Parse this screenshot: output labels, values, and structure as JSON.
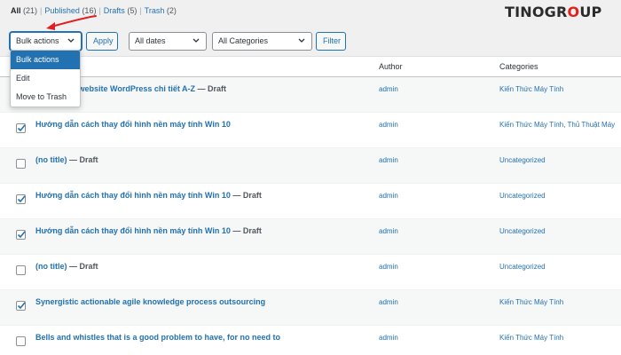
{
  "filters_nav": {
    "all_label": "All",
    "all_count": "(21)",
    "published_label": "Published",
    "published_count": "(16)",
    "drafts_label": "Drafts",
    "drafts_count": "(5)",
    "trash_label": "Trash",
    "trash_count": "(2)"
  },
  "brand": {
    "part1": "TINO",
    "part2": "GR",
    "o": "O",
    "part3": "UP"
  },
  "toolbar": {
    "bulk_actions_value": "Bulk actions",
    "apply_label": "Apply",
    "dates_value": "All dates",
    "categories_value": "All Categories",
    "filter_label": "Filter"
  },
  "bulk_menu": {
    "options": [
      "Bulk actions",
      "Edit",
      "Move to Trash"
    ]
  },
  "table": {
    "headers": {
      "author": "Author",
      "categories": "Categories"
    },
    "rows": [
      {
        "checked": false,
        "title": "i đăng trên website WordPress chi tiết A-Z",
        "state": "— Draft",
        "author": "admin",
        "categories": "Kiến Thức Máy Tính"
      },
      {
        "checked": true,
        "title": "Hướng dẫn cách thay đổi hình nền máy tính Win 10",
        "state": "",
        "author": "admin",
        "categories": "Kiến Thức Máy Tính, Thủ Thuật Máy"
      },
      {
        "checked": false,
        "title": "(no title)",
        "state": "— Draft",
        "author": "admin",
        "categories": "Uncategorized"
      },
      {
        "checked": true,
        "title": "Hướng dẫn cách thay đổi hình nền máy tính Win 10",
        "state": "— Draft",
        "author": "admin",
        "categories": "Uncategorized"
      },
      {
        "checked": true,
        "title": "Hướng dẫn cách thay đổi hình nền máy tính Win 10",
        "state": "— Draft",
        "author": "admin",
        "categories": "Uncategorized"
      },
      {
        "checked": false,
        "title": "(no title)",
        "state": "— Draft",
        "author": "admin",
        "categories": "Uncategorized"
      },
      {
        "checked": true,
        "title": "Synergistic actionable agile knowledge process outsourcing",
        "state": "",
        "author": "admin",
        "categories": "Kiến Thức Máy Tính"
      },
      {
        "checked": false,
        "title": "Bells and whistles that is a good problem to have, for no need to",
        "state": "",
        "author": "admin",
        "categories": "Kiến Thức Máy Tính"
      }
    ]
  },
  "colors": {
    "accent": "#2271b1",
    "brand_red": "#e2231a",
    "annotation_arrow": "#e02020"
  },
  "icons": {
    "dropdown": "chevron-down-icon",
    "checkbox": "checkmark-icon",
    "annotation": "red-arrow-icon"
  }
}
